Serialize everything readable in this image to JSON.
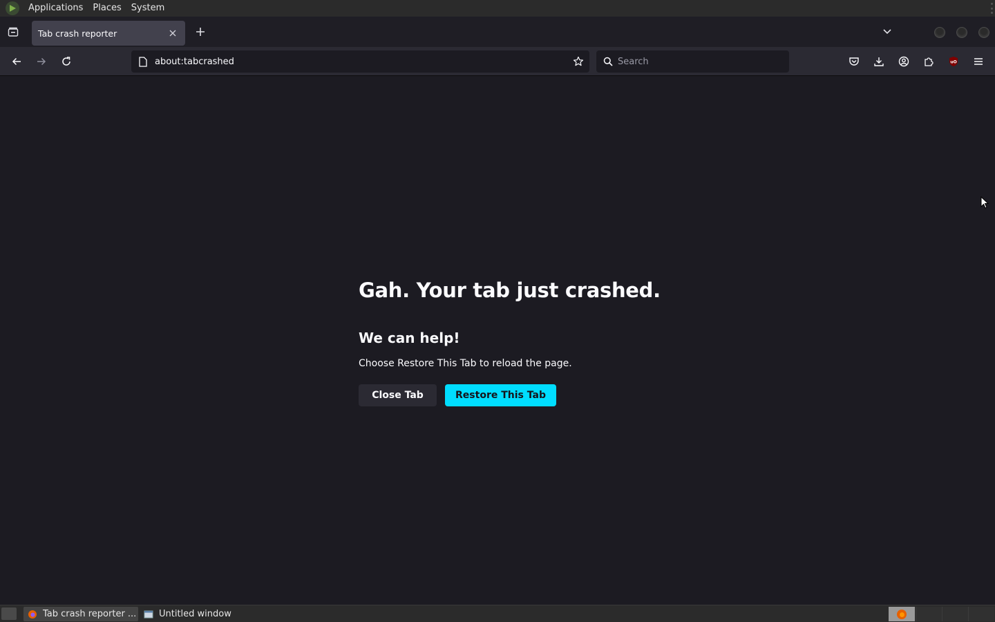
{
  "system_panel": {
    "menus": [
      "Applications",
      "Places",
      "System"
    ]
  },
  "browser": {
    "tab": {
      "title": "Tab crash reporter"
    },
    "url": "about:tabcrashed",
    "search_placeholder": "Search",
    "accent_color": "#00ddff"
  },
  "crash_page": {
    "title": "Gah. Your tab just crashed.",
    "subtitle": "We can help!",
    "message": "Choose Restore This Tab to reload the page.",
    "close_button": "Close Tab",
    "restore_button": "Restore This Tab"
  },
  "taskbar": {
    "tasks": [
      {
        "label": "Tab crash reporter ...",
        "icon": "firefox-icon"
      },
      {
        "label": "Untitled window",
        "icon": "window-icon"
      }
    ]
  }
}
